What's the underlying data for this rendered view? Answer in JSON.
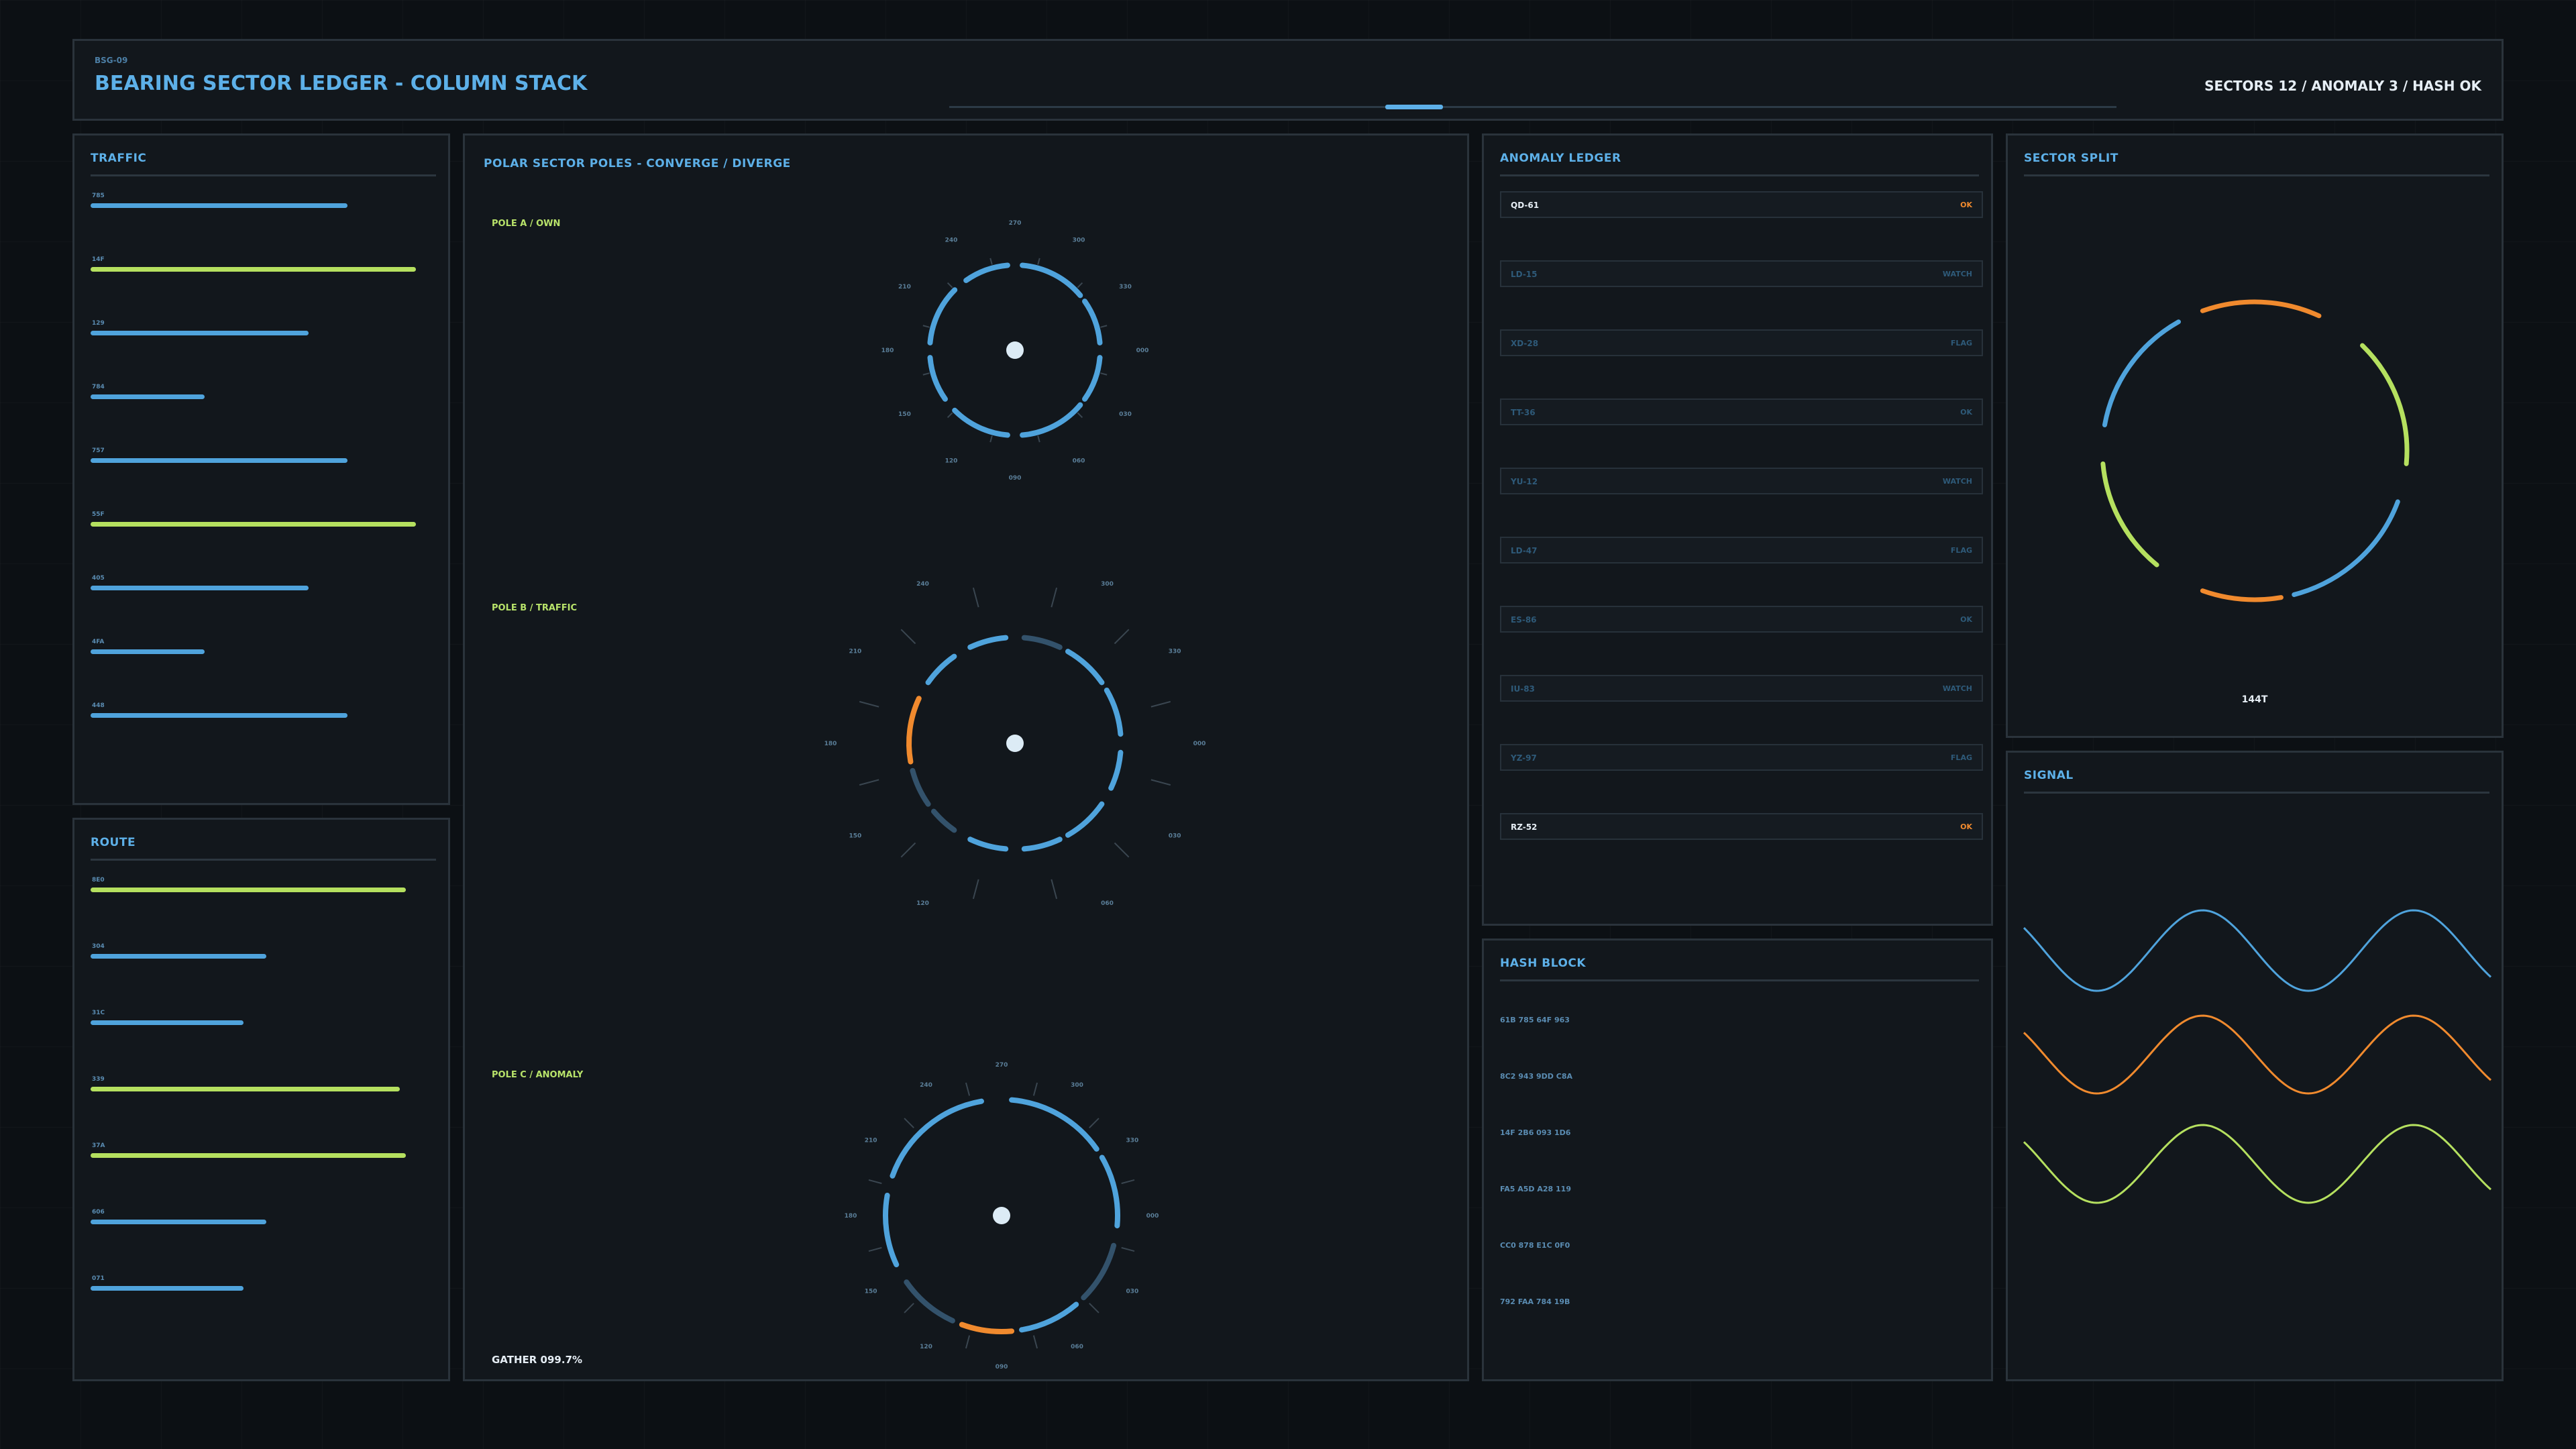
{
  "header": {
    "code": "BSG-09",
    "title": "BEARING SECTOR LEDGER - COLUMN STACK",
    "status": "SECTORS 12 / ANOMALY 3 / HASH OK"
  },
  "traffic": {
    "title": "TRAFFIC",
    "rows": [
      {
        "label": "785",
        "fraction": 0.79,
        "color": "#4fa3dc"
      },
      {
        "label": "14F",
        "fraction": 1.0,
        "color": "#b5e05f"
      },
      {
        "label": "129",
        "fraction": 0.67,
        "color": "#4fa3dc"
      },
      {
        "label": "784",
        "fraction": 0.35,
        "color": "#4fa3dc"
      },
      {
        "label": "757",
        "fraction": 0.79,
        "color": "#4fa3dc"
      },
      {
        "label": "55F",
        "fraction": 1.0,
        "color": "#b5e05f"
      },
      {
        "label": "405",
        "fraction": 0.67,
        "color": "#4fa3dc"
      },
      {
        "label": "4FA",
        "fraction": 0.35,
        "color": "#4fa3dc"
      },
      {
        "label": "448",
        "fraction": 0.79,
        "color": "#4fa3dc"
      }
    ]
  },
  "route": {
    "title": "ROUTE",
    "rows": [
      {
        "label": "8E0",
        "fraction": 0.97,
        "color": "#b5e05f"
      },
      {
        "label": "304",
        "fraction": 0.54,
        "color": "#4fa3dc"
      },
      {
        "label": "31C",
        "fraction": 0.47,
        "color": "#4fa3dc"
      },
      {
        "label": "339",
        "fraction": 0.95,
        "color": "#b5e05f"
      },
      {
        "label": "37A",
        "fraction": 0.97,
        "color": "#b5e05f"
      },
      {
        "label": "606",
        "fraction": 0.54,
        "color": "#4fa3dc"
      },
      {
        "label": "071",
        "fraction": 0.47,
        "color": "#4fa3dc"
      }
    ]
  },
  "polar": {
    "title": "POLAR SECTOR POLES - CONVERGE / DIVERGE",
    "gather": "GATHER 099.7%",
    "poles": [
      {
        "label": "POLE A / OWN",
        "ticks": [
          "270",
          "300",
          "330",
          "000",
          "030",
          "060",
          "090",
          "120",
          "150",
          "180",
          "210",
          "240"
        ]
      },
      {
        "label": "POLE B / TRAFFIC",
        "ticks": [
          "270",
          "300",
          "330",
          "000",
          "030",
          "060",
          "090",
          "120",
          "150",
          "180",
          "210",
          "240"
        ]
      },
      {
        "label": "POLE C / ANOMALY",
        "ticks": [
          "270",
          "300",
          "330",
          "000",
          "030",
          "060",
          "090",
          "120",
          "150",
          "180",
          "210",
          "240"
        ]
      }
    ]
  },
  "anomaly": {
    "title": "ANOMALY LEDGER",
    "rows": [
      {
        "id": "QD-61",
        "status": "OK",
        "highlight": true
      },
      {
        "id": "LD-15",
        "status": "WATCH",
        "highlight": false
      },
      {
        "id": "XD-28",
        "status": "FLAG",
        "highlight": false
      },
      {
        "id": "TT-36",
        "status": "OK",
        "highlight": false
      },
      {
        "id": "YU-12",
        "status": "WATCH",
        "highlight": false
      },
      {
        "id": "LD-47",
        "status": "FLAG",
        "highlight": false
      },
      {
        "id": "ES-86",
        "status": "OK",
        "highlight": false
      },
      {
        "id": "IU-83",
        "status": "WATCH",
        "highlight": false
      },
      {
        "id": "YZ-97",
        "status": "FLAG",
        "highlight": false
      },
      {
        "id": "RZ-52",
        "status": "OK",
        "highlight": true
      }
    ]
  },
  "hash": {
    "title": "HASH BLOCK",
    "lines": [
      "61B 785 64F 963",
      "8C2 943 9DD C8A",
      "14F 2B6 093 1D6",
      "FA5 A5D A28 119",
      "CC0 878 E1C 0F0",
      "792 FAA 784 19B"
    ]
  },
  "split": {
    "title": "SECTOR SPLIT",
    "value": "144T"
  },
  "signal": {
    "title": "SIGNAL"
  },
  "colors": {
    "blue": "#4fa3dc",
    "green": "#b5e05f",
    "orange": "#f08a2e",
    "dim": "#33526b"
  }
}
